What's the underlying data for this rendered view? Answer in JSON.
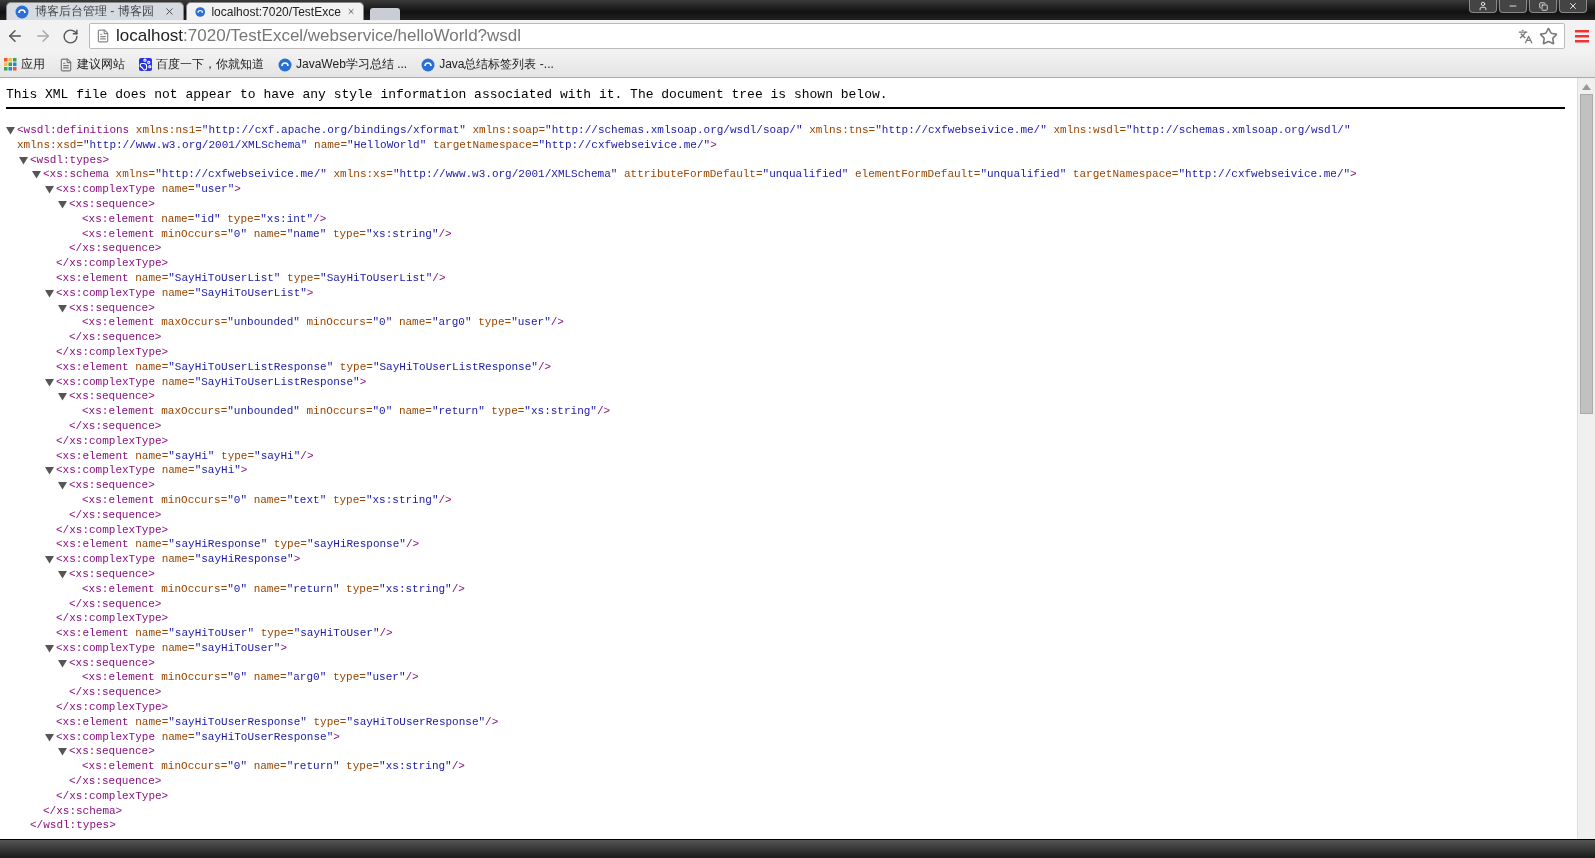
{
  "browser": {
    "tabs": [
      {
        "title": "博客后台管理 - 博客园",
        "selected": false
      },
      {
        "title": "localhost:7020/TestExce",
        "selected": true
      }
    ],
    "nav": {
      "forward_disabled": true
    },
    "address": {
      "host": "localhost",
      "rest": ":7020/TestExcel/webservice/helloWorld?wsdl"
    },
    "bookmarks": [
      {
        "label": "应用",
        "kind": "apps"
      },
      {
        "label": "建议网站",
        "kind": "page"
      },
      {
        "label": "百度一下，你就知道",
        "kind": "paw"
      },
      {
        "label": "JavaWeb学习总结 ...",
        "kind": "site"
      },
      {
        "label": "Java总结标签列表 -...",
        "kind": "site"
      }
    ]
  },
  "notice": "This XML file does not appear to have any style information associated with it. The document tree is shown below.",
  "tree": {
    "open": [
      "<wsdl:definitions",
      " xmlns:ns1=",
      "\"http://cxf.apache.org/bindings/xformat\"",
      " xmlns:soap=",
      "\"http://schemas.xmlsoap.org/wsdl/soap/\"",
      " xmlns:tns=",
      "\"http://cxfwebseivice.me/\"",
      " xmlns:wsdl=",
      "\"http://schemas.xmlsoap.org/wsdl/\"",
      " xmlns:xsd=",
      "\"http://www.w3.org/2001/XMLSchema\"",
      " name=",
      "\"HelloWorld\"",
      " targetNamespace=",
      "\"http://cxfwebseivice.me/\"",
      ">"
    ],
    "expanded": true,
    "children": [
      {
        "open": [
          "<wsdl:types>"
        ],
        "expanded": true,
        "close": "</wsdl:types>",
        "children": [
          {
            "open": [
              "<xs:schema",
              " xmlns=",
              "\"http://cxfwebseivice.me/\"",
              " xmlns:xs=",
              "\"http://www.w3.org/2001/XMLSchema\"",
              " attributeFormDefault=",
              "\"unqualified\"",
              " elementFormDefault=",
              "\"unqualified\"",
              " targetNamespace=",
              "\"http://cxfwebseivice.me/\"",
              ">"
            ],
            "expanded": true,
            "close": "</xs:schema>",
            "children": [
              {
                "open": [
                  "<xs:complexType",
                  " name=",
                  "\"user\"",
                  ">"
                ],
                "expanded": true,
                "close": "</xs:complexType>",
                "children": [
                  {
                    "open": [
                      "<xs:sequence>"
                    ],
                    "expanded": true,
                    "close": "</xs:sequence>",
                    "children": [
                      {
                        "open": [
                          "<xs:element",
                          " name=",
                          "\"id\"",
                          " type=",
                          "\"xs:int\"",
                          "/>"
                        ]
                      },
                      {
                        "open": [
                          "<xs:element",
                          " minOccurs=",
                          "\"0\"",
                          " name=",
                          "\"name\"",
                          " type=",
                          "\"xs:string\"",
                          "/>"
                        ]
                      }
                    ]
                  }
                ]
              },
              {
                "open": [
                  "<xs:element",
                  " name=",
                  "\"SayHiToUserList\"",
                  " type=",
                  "\"SayHiToUserList\"",
                  "/>"
                ]
              },
              {
                "open": [
                  "<xs:complexType",
                  " name=",
                  "\"SayHiToUserList\"",
                  ">"
                ],
                "expanded": true,
                "close": "</xs:complexType>",
                "children": [
                  {
                    "open": [
                      "<xs:sequence>"
                    ],
                    "expanded": true,
                    "close": "</xs:sequence>",
                    "children": [
                      {
                        "open": [
                          "<xs:element",
                          " maxOccurs=",
                          "\"unbounded\"",
                          " minOccurs=",
                          "\"0\"",
                          " name=",
                          "\"arg0\"",
                          " type=",
                          "\"user\"",
                          "/>"
                        ]
                      }
                    ]
                  }
                ]
              },
              {
                "open": [
                  "<xs:element",
                  " name=",
                  "\"SayHiToUserListResponse\"",
                  " type=",
                  "\"SayHiToUserListResponse\"",
                  "/>"
                ]
              },
              {
                "open": [
                  "<xs:complexType",
                  " name=",
                  "\"SayHiToUserListResponse\"",
                  ">"
                ],
                "expanded": true,
                "close": "</xs:complexType>",
                "children": [
                  {
                    "open": [
                      "<xs:sequence>"
                    ],
                    "expanded": true,
                    "close": "</xs:sequence>",
                    "children": [
                      {
                        "open": [
                          "<xs:element",
                          " maxOccurs=",
                          "\"unbounded\"",
                          " minOccurs=",
                          "\"0\"",
                          " name=",
                          "\"return\"",
                          " type=",
                          "\"xs:string\"",
                          "/>"
                        ]
                      }
                    ]
                  }
                ]
              },
              {
                "open": [
                  "<xs:element",
                  " name=",
                  "\"sayHi\"",
                  " type=",
                  "\"sayHi\"",
                  "/>"
                ]
              },
              {
                "open": [
                  "<xs:complexType",
                  " name=",
                  "\"sayHi\"",
                  ">"
                ],
                "expanded": true,
                "close": "</xs:complexType>",
                "children": [
                  {
                    "open": [
                      "<xs:sequence>"
                    ],
                    "expanded": true,
                    "close": "</xs:sequence>",
                    "children": [
                      {
                        "open": [
                          "<xs:element",
                          " minOccurs=",
                          "\"0\"",
                          " name=",
                          "\"text\"",
                          " type=",
                          "\"xs:string\"",
                          "/>"
                        ]
                      }
                    ]
                  }
                ]
              },
              {
                "open": [
                  "<xs:element",
                  " name=",
                  "\"sayHiResponse\"",
                  " type=",
                  "\"sayHiResponse\"",
                  "/>"
                ]
              },
              {
                "open": [
                  "<xs:complexType",
                  " name=",
                  "\"sayHiResponse\"",
                  ">"
                ],
                "expanded": true,
                "close": "</xs:complexType>",
                "children": [
                  {
                    "open": [
                      "<xs:sequence>"
                    ],
                    "expanded": true,
                    "close": "</xs:sequence>",
                    "children": [
                      {
                        "open": [
                          "<xs:element",
                          " minOccurs=",
                          "\"0\"",
                          " name=",
                          "\"return\"",
                          " type=",
                          "\"xs:string\"",
                          "/>"
                        ]
                      }
                    ]
                  }
                ]
              },
              {
                "open": [
                  "<xs:element",
                  " name=",
                  "\"sayHiToUser\"",
                  " type=",
                  "\"sayHiToUser\"",
                  "/>"
                ]
              },
              {
                "open": [
                  "<xs:complexType",
                  " name=",
                  "\"sayHiToUser\"",
                  ">"
                ],
                "expanded": true,
                "close": "</xs:complexType>",
                "children": [
                  {
                    "open": [
                      "<xs:sequence>"
                    ],
                    "expanded": true,
                    "close": "</xs:sequence>",
                    "children": [
                      {
                        "open": [
                          "<xs:element",
                          " minOccurs=",
                          "\"0\"",
                          " name=",
                          "\"arg0\"",
                          " type=",
                          "\"user\"",
                          "/>"
                        ]
                      }
                    ]
                  }
                ]
              },
              {
                "open": [
                  "<xs:element",
                  " name=",
                  "\"sayHiToUserResponse\"",
                  " type=",
                  "\"sayHiToUserResponse\"",
                  "/>"
                ]
              },
              {
                "open": [
                  "<xs:complexType",
                  " name=",
                  "\"sayHiToUserResponse\"",
                  ">"
                ],
                "expanded": true,
                "close": "</xs:complexType>",
                "children": [
                  {
                    "open": [
                      "<xs:sequence>"
                    ],
                    "expanded": true,
                    "close": "</xs:sequence>",
                    "children": [
                      {
                        "open": [
                          "<xs:element",
                          " minOccurs=",
                          "\"0\"",
                          " name=",
                          "\"return\"",
                          " type=",
                          "\"xs:string\"",
                          "/>"
                        ]
                      }
                    ]
                  }
                ]
              }
            ]
          }
        ]
      }
    ]
  }
}
